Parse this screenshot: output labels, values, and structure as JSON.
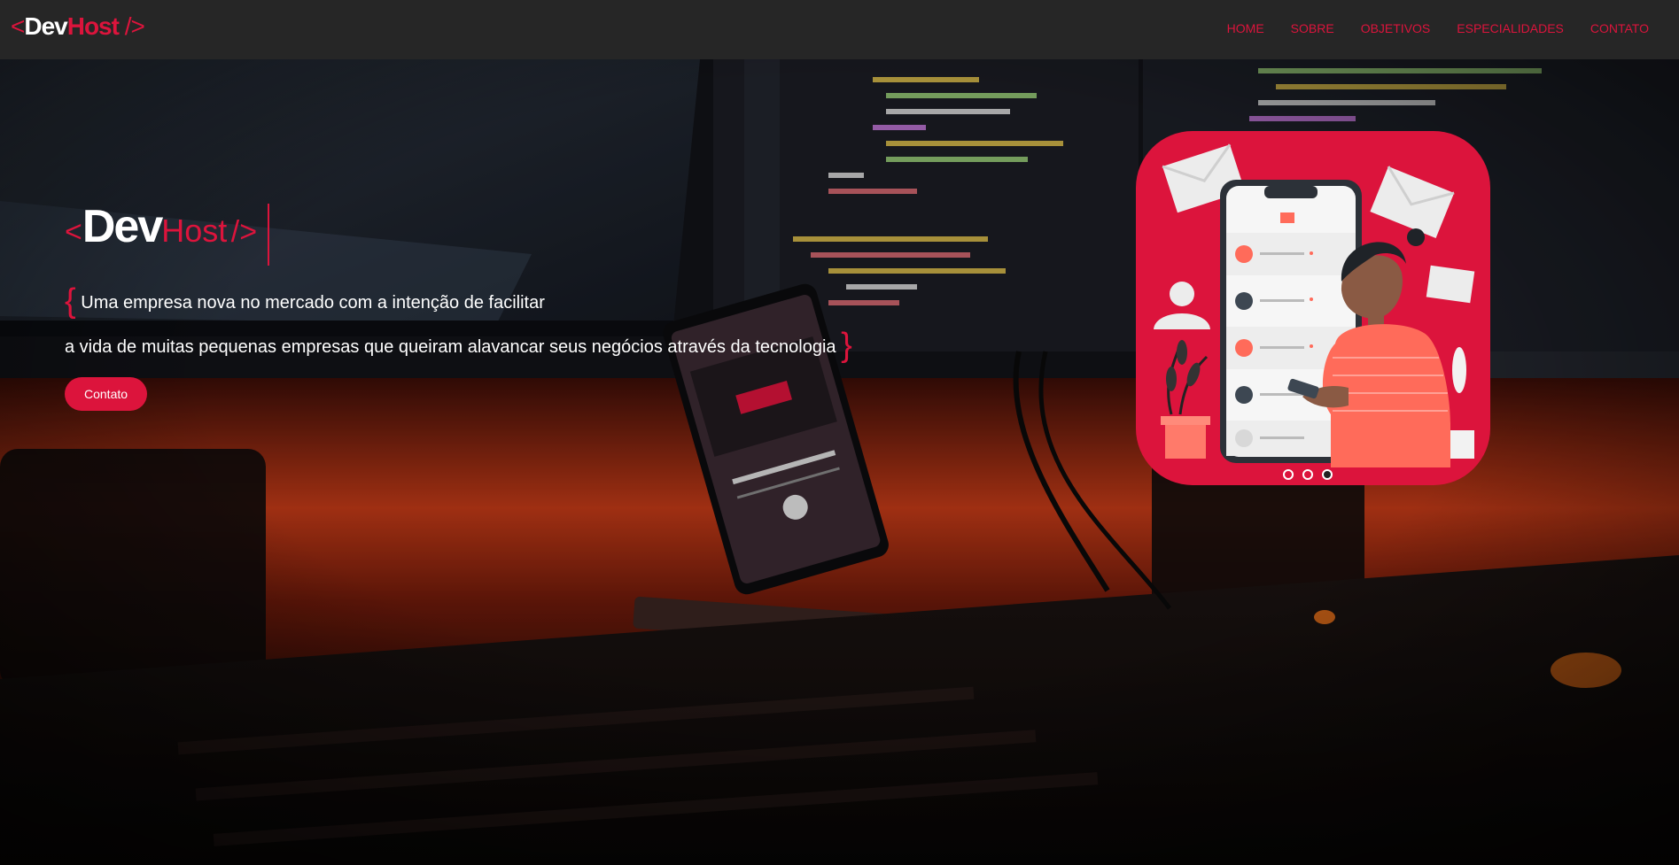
{
  "header": {
    "logo": {
      "open": "<",
      "dev": "Dev",
      "host": "Host",
      "close": "/>"
    },
    "nav": [
      {
        "label": "HOME"
      },
      {
        "label": "SOBRE"
      },
      {
        "label": "OBJETIVOS"
      },
      {
        "label": "ESPECIALIDADES"
      },
      {
        "label": "CONTATO"
      }
    ]
  },
  "hero": {
    "logo": {
      "open": "<",
      "dev": "Dev",
      "host": "Host",
      "close": "/>"
    },
    "curly_open": "{",
    "line1": "Uma empresa nova no mercado com a intenção de facilitar",
    "line2": "a vida de muitas pequenas empresas que queiram alavancar seus negócios através da tecnologia",
    "curly_close": "}",
    "cta_label": "Contato"
  },
  "carousel": {
    "slide_count": 3,
    "active_index": 2
  },
  "colors": {
    "accent": "#dc143c",
    "topbar": "#262626",
    "text": "#ffffff"
  },
  "icons": [
    "user-circle-icon",
    "mail-icon",
    "envelope-icon",
    "person-icon",
    "plant-icon",
    "smartphone-icon"
  ]
}
